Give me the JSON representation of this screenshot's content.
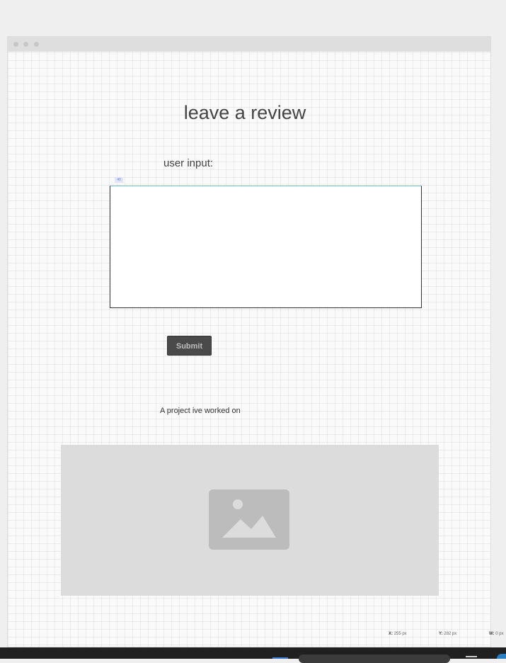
{
  "page": {
    "title": "leave a review",
    "input_label": "user input:",
    "size_tag": "40",
    "input_value": "",
    "submit_label": "Submit",
    "project_caption": "A project ive worked on"
  },
  "readout": {
    "x_label": "X:",
    "x_value": "255 px",
    "y_label": "Y:",
    "y_value": "282 px",
    "w_label": "W:",
    "w_value": "0 px"
  },
  "icons": {
    "window_dots": "dot",
    "image_placeholder": "image-icon"
  },
  "colors": {
    "background": "#efefef",
    "canvas": "#fafafa",
    "button": "#4a4a4a",
    "placeholder": "#dcdcdc",
    "taskbar": "#202020"
  }
}
